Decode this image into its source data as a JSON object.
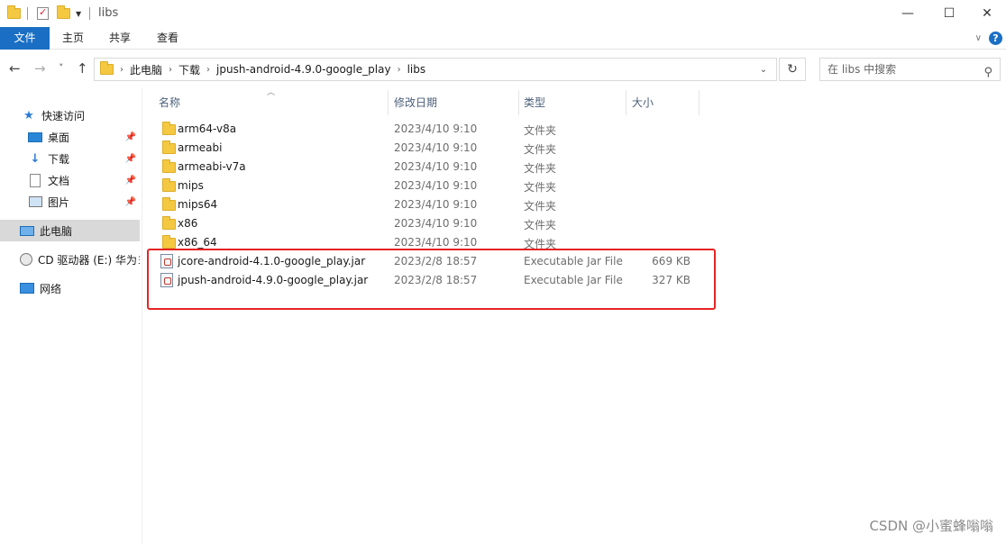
{
  "window": {
    "title": "libs",
    "minimize_glyph": "—",
    "maximize_glyph": "☐",
    "close_glyph": "✕"
  },
  "ribbon": {
    "tabs": [
      {
        "label": "文件",
        "active": true
      },
      {
        "label": "主页"
      },
      {
        "label": "共享"
      },
      {
        "label": "查看"
      }
    ]
  },
  "nav": {
    "back_glyph": "←",
    "forward_glyph": "→",
    "recent_glyph": "˅",
    "up_glyph": "↑",
    "breadcrumb": [
      "此电脑",
      "下载",
      "jpush-android-4.9.0-google_play",
      "libs"
    ],
    "refresh_glyph": "↻",
    "search_placeholder": "在 libs 中搜索",
    "search_icon": "search-icon"
  },
  "sidebar": {
    "items": [
      {
        "label": "快速访问",
        "icon": "star-icon"
      },
      {
        "label": "桌面",
        "icon": "desktop-icon",
        "pinned": true
      },
      {
        "label": "下载",
        "icon": "download-icon",
        "pinned": true
      },
      {
        "label": "文档",
        "icon": "document-icon",
        "pinned": true
      },
      {
        "label": "图片",
        "icon": "picture-icon",
        "pinned": true
      },
      {
        "label": "此电脑",
        "icon": "computer-icon",
        "active": true
      },
      {
        "label": "CD 驱动器 (E:) 华为ヨ",
        "icon": "cd-drive-icon"
      },
      {
        "label": "网络",
        "icon": "network-icon"
      }
    ]
  },
  "columns": {
    "name": "名称",
    "date": "修改日期",
    "type": "类型",
    "size": "大小"
  },
  "files": [
    {
      "name": "arm64-v8a",
      "date": "2023/4/10 9:10",
      "type": "文件夹",
      "size": "",
      "kind": "folder"
    },
    {
      "name": "armeabi",
      "date": "2023/4/10 9:10",
      "type": "文件夹",
      "size": "",
      "kind": "folder"
    },
    {
      "name": "armeabi-v7a",
      "date": "2023/4/10 9:10",
      "type": "文件夹",
      "size": "",
      "kind": "folder"
    },
    {
      "name": "mips",
      "date": "2023/4/10 9:10",
      "type": "文件夹",
      "size": "",
      "kind": "folder"
    },
    {
      "name": "mips64",
      "date": "2023/4/10 9:10",
      "type": "文件夹",
      "size": "",
      "kind": "folder"
    },
    {
      "name": "x86",
      "date": "2023/4/10 9:10",
      "type": "文件夹",
      "size": "",
      "kind": "folder"
    },
    {
      "name": "x86_64",
      "date": "2023/4/10 9:10",
      "type": "文件夹",
      "size": "",
      "kind": "folder"
    },
    {
      "name": "jcore-android-4.1.0-google_play.jar",
      "date": "2023/2/8 18:57",
      "type": "Executable Jar File",
      "size": "669 KB",
      "kind": "jar"
    },
    {
      "name": "jpush-android-4.9.0-google_play.jar",
      "date": "2023/2/8 18:57",
      "type": "Executable Jar File",
      "size": "327 KB",
      "kind": "jar"
    }
  ],
  "watermark": "CSDN @小蜜蜂嗡嗡",
  "colors": {
    "accent": "#1a6fc4",
    "highlight_border": "#e52424",
    "folder": "#f5c842"
  }
}
